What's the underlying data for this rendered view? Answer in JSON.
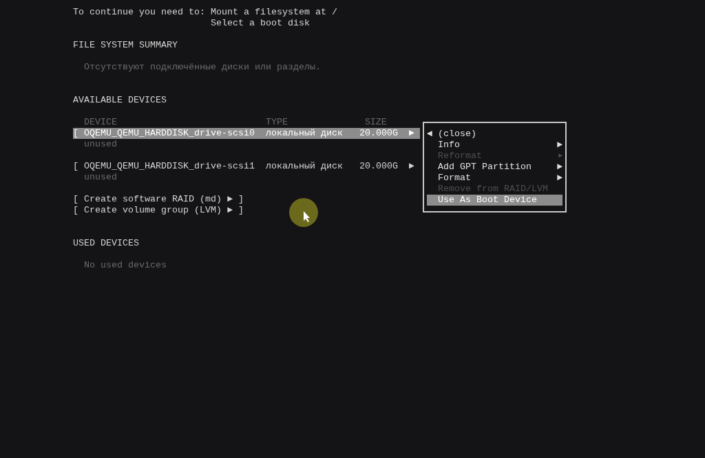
{
  "notice": {
    "label": "To continue you need to:",
    "items": [
      "Mount a filesystem at /",
      "Select a boot disk"
    ]
  },
  "file_system_summary": {
    "heading": "FILE SYSTEM SUMMARY",
    "message": "Отсутствуют подключённые диски или разделы."
  },
  "available_devices": {
    "heading": "AVAILABLE DEVICES",
    "columns": [
      "DEVICE",
      "TYPE",
      "SIZE"
    ],
    "devices": [
      {
        "bracket": "[",
        "name": "OQEMU_QEMU_HARDDISK_drive-scsi0",
        "type": "локальный диск",
        "size": "20.000G",
        "arrow": "►",
        "status": "unused",
        "selected": true
      },
      {
        "bracket": "[",
        "name": "OQEMU_QEMU_HARDDISK_drive-scsi1",
        "type": "локальный диск",
        "size": "20.000G",
        "arrow": "►",
        "status": "unused",
        "selected": false
      }
    ],
    "actions": [
      "[ Create software RAID (md) ► ]",
      "[ Create volume group (LVM) ► ]"
    ]
  },
  "used_devices": {
    "heading": "USED DEVICES",
    "message": "No used devices"
  },
  "menu": {
    "items": [
      {
        "kind": "close",
        "marker": "◄",
        "label": "(close)",
        "disabled": false,
        "selected": false
      },
      {
        "kind": "submenu",
        "label": "Info",
        "arrow": "►",
        "disabled": false,
        "selected": false
      },
      {
        "kind": "submenu",
        "label": "Reformat",
        "arrow": "►",
        "disabled": true,
        "selected": false
      },
      {
        "kind": "submenu",
        "label": "Add GPT Partition",
        "arrow": "►",
        "disabled": false,
        "selected": false
      },
      {
        "kind": "submenu",
        "label": "Format",
        "arrow": "►",
        "disabled": false,
        "selected": false
      },
      {
        "kind": "action",
        "label": "Remove from RAID/LVM",
        "disabled": true,
        "selected": false
      },
      {
        "kind": "action",
        "label": "Use As Boot Device",
        "disabled": false,
        "selected": true
      }
    ]
  }
}
